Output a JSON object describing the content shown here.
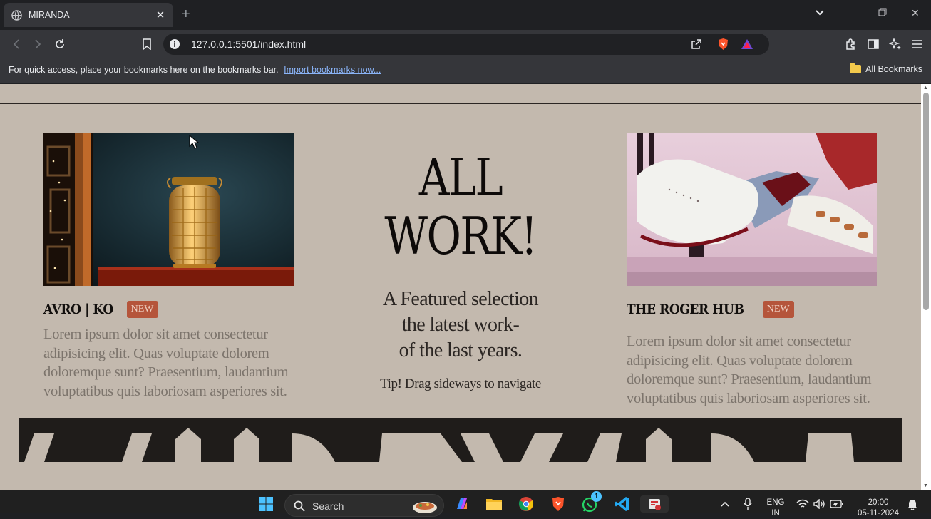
{
  "browser": {
    "tab_title": "MIRANDA",
    "url": "127.0.0.1:5501/index.html",
    "bookmarks_message": "For quick access, place your bookmarks here on the bookmarks bar.",
    "import_link": "Import bookmarks now...",
    "all_bookmarks": "All Bookmarks"
  },
  "page": {
    "cards": [
      {
        "title": "AVRO | KO",
        "badge": "NEW",
        "text": "Lorem ipsum dolor sit amet consectetur adipisicing elit. Quas voluptate dolorem doloremque sunt? Praesentium, laudantium voluptatibus quis laboriosam asperiores sit."
      },
      {
        "title": "THE ROGER HUB",
        "badge": "NEW",
        "text": "Lorem ipsum dolor sit amet consectetur adipisicing elit. Quas voluptate dolorem doloremque sunt? Praesentium, laudantium voluptatibus quis laboriosam asperiores sit."
      }
    ],
    "hero": {
      "title_line1": "ALL",
      "title_line2": "WORK!",
      "sub_line1": "A Featured selection",
      "sub_line2": "the latest work-",
      "sub_line3": "of the last years.",
      "tip": "Tip! Drag sideways to navigate"
    }
  },
  "taskbar": {
    "search_label": "Search",
    "language": "ENG",
    "region": "IN",
    "time": "20:00",
    "date": "05-11-2024",
    "whatsapp_badge": "1"
  },
  "colors": {
    "page_bg": "#c3b9ae",
    "badge": "#b5553b",
    "ink": "#0d0a09"
  }
}
